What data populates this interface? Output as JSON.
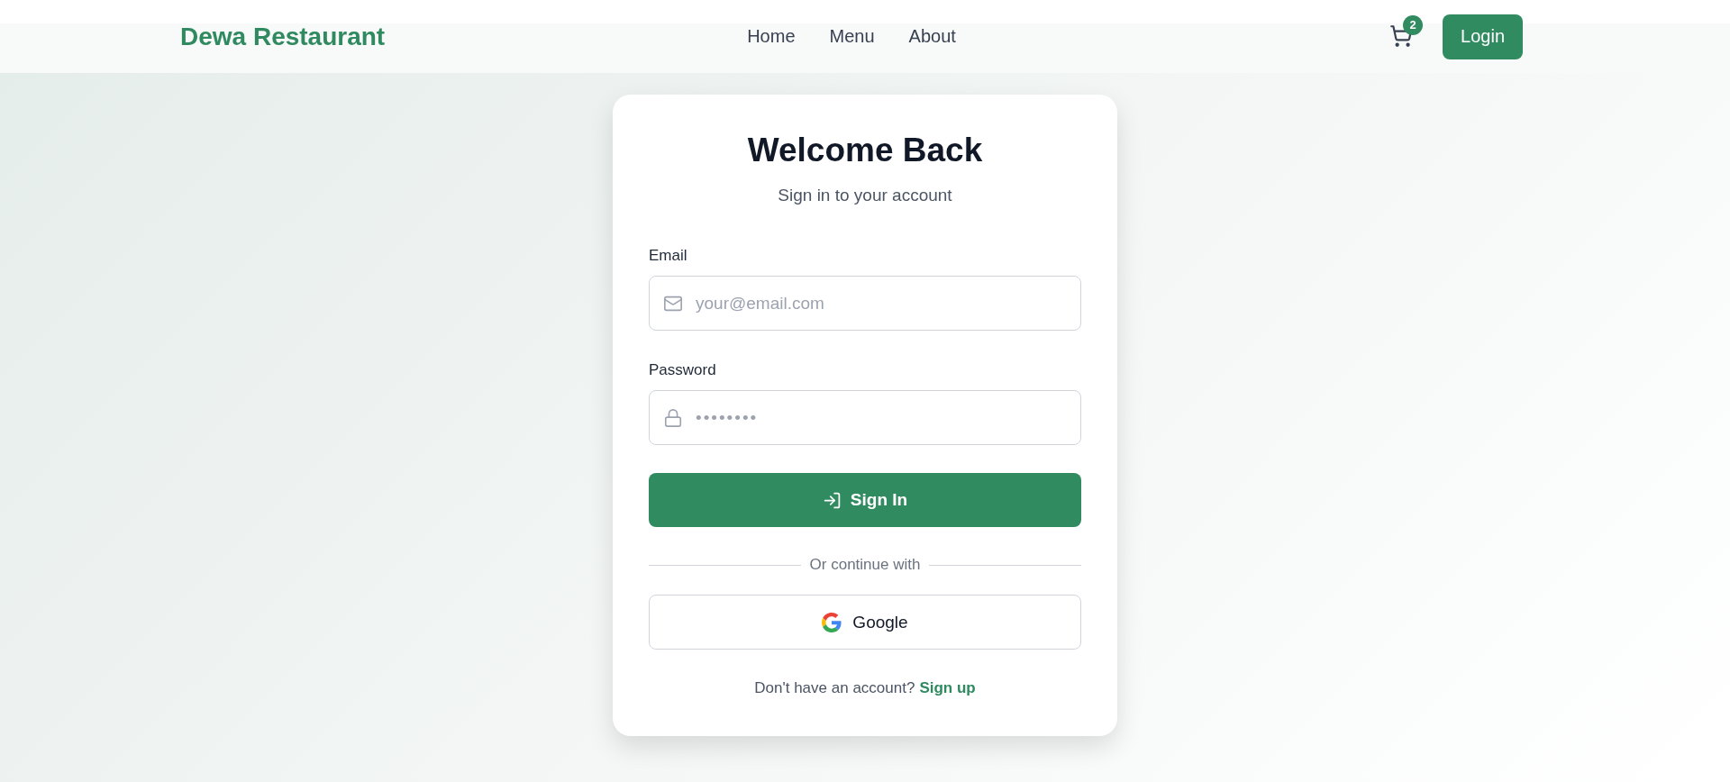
{
  "header": {
    "brand": "Dewa Restaurant",
    "nav": [
      {
        "label": "Home"
      },
      {
        "label": "Menu"
      },
      {
        "label": "About"
      }
    ],
    "cart_badge": "2",
    "login_button": "Login"
  },
  "login_card": {
    "title": "Welcome Back",
    "subtitle": "Sign in to your account",
    "fields": [
      {
        "kind": "email",
        "label": "Email",
        "placeholder": "your@email.com"
      },
      {
        "kind": "password",
        "label": "Password",
        "placeholder": "••••••••"
      }
    ],
    "submit_button": "Sign In",
    "divider_text": "Or continue with",
    "social_button": "Google",
    "footer": {
      "text": "Don't have an account?",
      "link": "Sign up"
    }
  }
}
